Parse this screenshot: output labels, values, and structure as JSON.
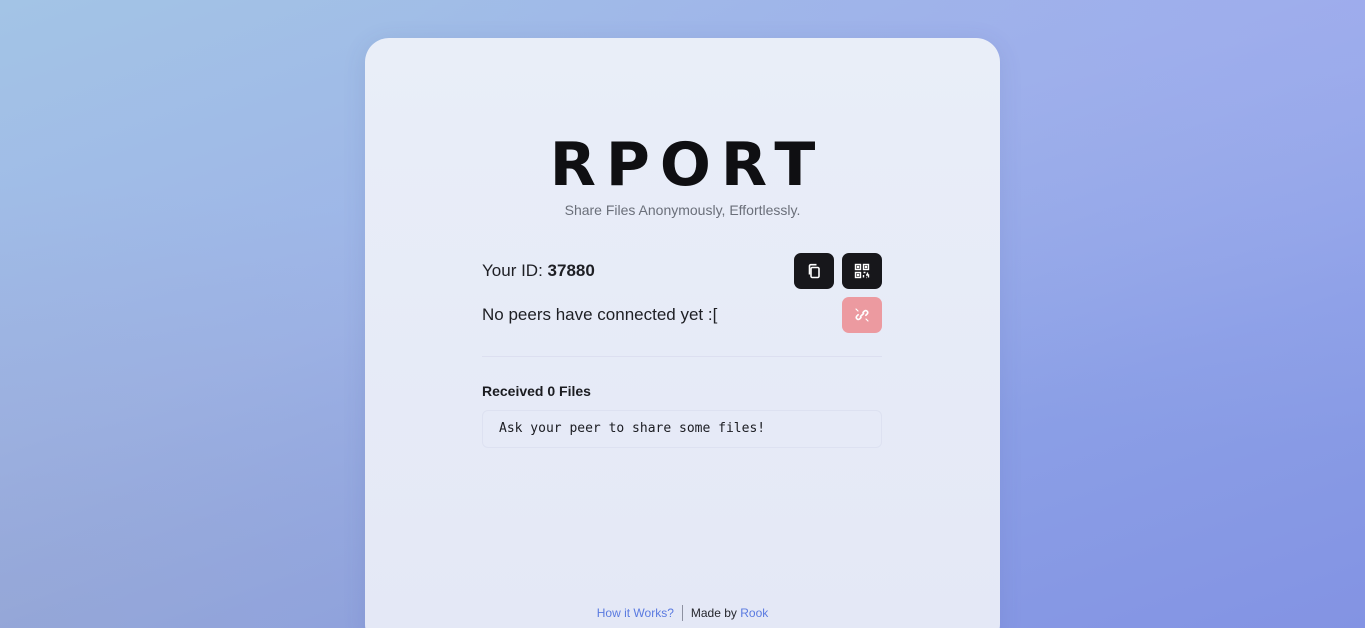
{
  "app": {
    "title": "RPORT",
    "subtitle": "Share Files Anonymously, Effortlessly."
  },
  "identity": {
    "id_label": "Your ID:",
    "id_value": "37880"
  },
  "peers": {
    "status_text": "No peers have connected yet :["
  },
  "received": {
    "title": "Received 0 Files",
    "empty_message": "Ask your peer to share some files!"
  },
  "footer": {
    "how_link": "How it Works?",
    "made_by": "Made by",
    "author_link": "Rook"
  },
  "icons": {
    "copy": "copy-icon",
    "qr": "qr-code-icon",
    "disconnect": "unlink-icon"
  },
  "colors": {
    "button_dark": "#17171b",
    "button_disabled_red": "#ec9aa0",
    "link": "#5a7ae0"
  }
}
